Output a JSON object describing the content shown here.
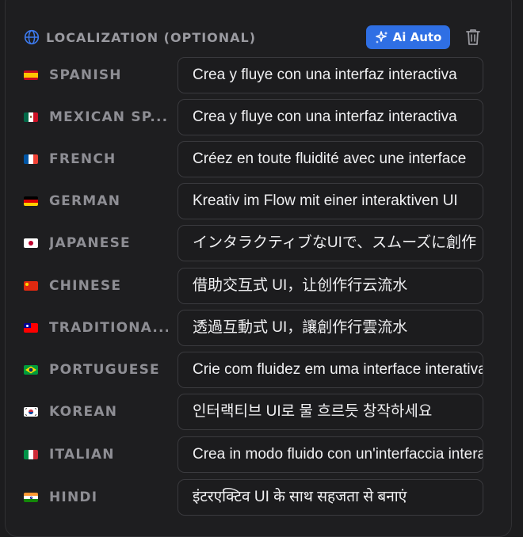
{
  "header": {
    "title": "LOCALIZATION (OPTIONAL)",
    "globe_icon": "globe-icon",
    "ai_button_label": "Ai Auto",
    "ai_icon": "sparkles-icon",
    "delete_icon": "trash-icon",
    "accent_color": "#2f6fe4"
  },
  "rows": [
    {
      "language": "SPANISH",
      "flag": "spain-flag-icon",
      "text": "Crea y fluye con una interfaz interactiva"
    },
    {
      "language": "MEXICAN SP...",
      "flag": "mexico-flag-icon",
      "text": "Crea y fluye con una interfaz interactiva"
    },
    {
      "language": "FRENCH",
      "flag": "france-flag-icon",
      "text": "Créez en toute fluidité avec une interface"
    },
    {
      "language": "GERMAN",
      "flag": "germany-flag-icon",
      "text": "Kreativ im Flow mit einer interaktiven UI"
    },
    {
      "language": "JAPANESE",
      "flag": "japan-flag-icon",
      "text": "インタラクティブなUIで、スムーズに創作"
    },
    {
      "language": "CHINESE",
      "flag": "china-flag-icon",
      "text": "借助交互式 UI，让创作行云流水"
    },
    {
      "language": "TRADITIONA...",
      "flag": "taiwan-flag-icon",
      "text": "透過互動式 UI，讓創作行雲流水"
    },
    {
      "language": "PORTUGUESE",
      "flag": "brazil-flag-icon",
      "text": "Crie com fluidez em uma interface interativa"
    },
    {
      "language": "KOREAN",
      "flag": "korea-flag-icon",
      "text": "인터랙티브 UI로 물 흐르듯 창작하세요"
    },
    {
      "language": "ITALIAN",
      "flag": "italy-flag-icon",
      "text": "Crea in modo fluido con un'interfaccia interattiva"
    },
    {
      "language": "HINDI",
      "flag": "india-flag-icon",
      "text": "इंटरएक्टिव UI के साथ सहजता से बनाएं"
    }
  ]
}
